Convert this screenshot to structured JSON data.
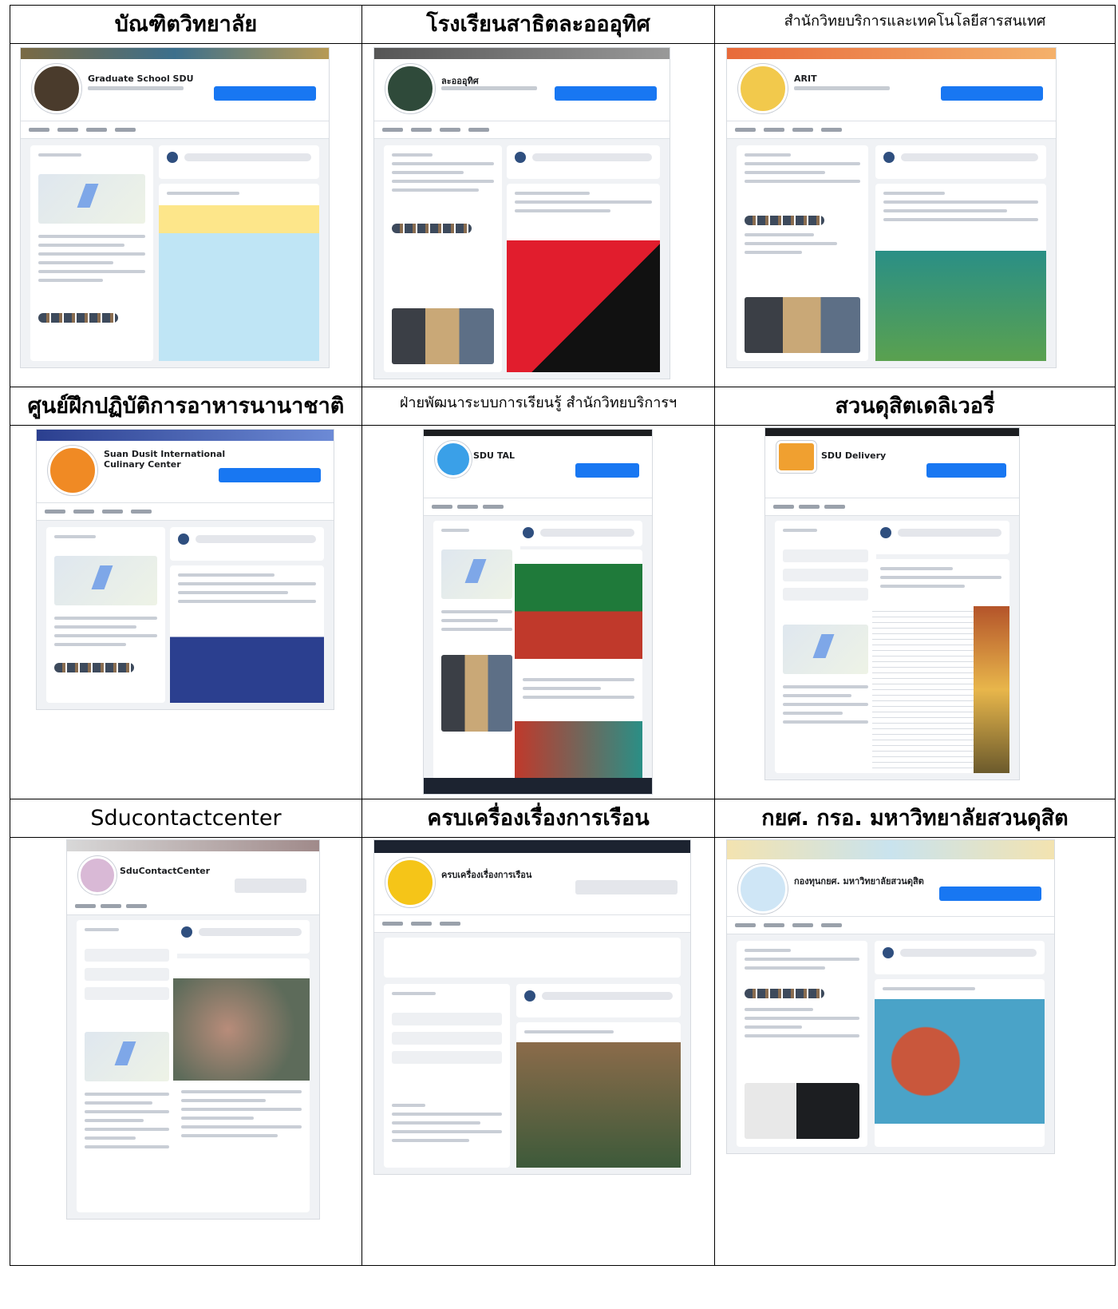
{
  "table": {
    "row1": {
      "col1": {
        "title": "บัณฑิตวิทยาลัย",
        "page_name": "Graduate School SDU"
      },
      "col2": {
        "title": "โรงเรียนสาธิตละอออุทิศ",
        "page_name": "ละอออุทิศ"
      },
      "col3": {
        "title": "สำนักวิทยบริการและเทคโนโลยีสารสนเทศ",
        "page_name": "ARIT"
      }
    },
    "row2": {
      "col1": {
        "title": "ศูนย์ฝึกปฏิบัติการอาหารนานาชาติ",
        "page_name": "Suan Dusit International Culinary Center"
      },
      "col2": {
        "title": "ฝ่ายพัฒนาระบบการเรียนรู้ สำนักวิทยบริการฯ",
        "page_name": "SDU TAL"
      },
      "col3": {
        "title": "สวนดุสิตเดลิเวอรี่",
        "page_name": "SDU Delivery"
      }
    },
    "row3": {
      "col1": {
        "title": "Sducontactcenter",
        "page_name": "SduContactCenter"
      },
      "col2": {
        "title": "ครบเครื่องเรื่องการเรือน",
        "page_name": "ครบเครื่องเรื่องการเรือน"
      },
      "col3": {
        "title": "กยศ. กรอ. มหาวิทยาลัยสวนดุสิต",
        "page_name": "กองทุนกยศ. มหาวิทยาลัยสวนดุสิต"
      }
    }
  },
  "colors": {
    "facebook_blue": "#1877f2",
    "border": "#000000",
    "fb_background": "#f0f2f5"
  }
}
